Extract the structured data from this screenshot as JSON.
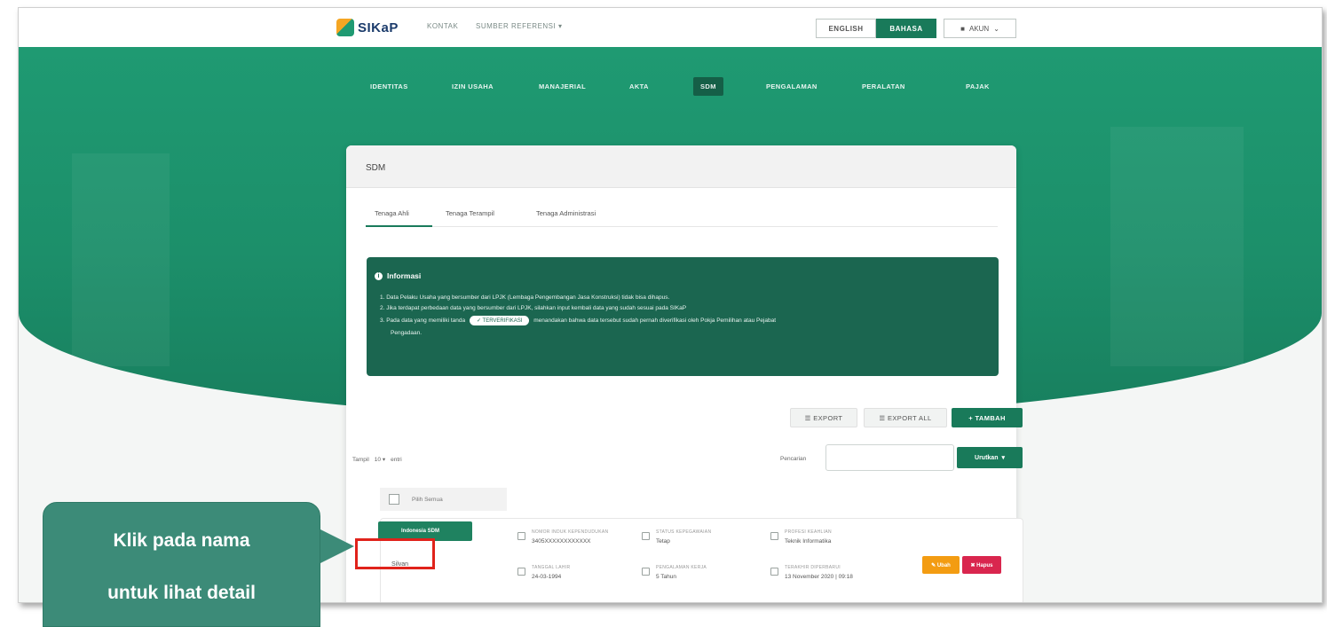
{
  "header": {
    "logo_text": "SIKaP",
    "links": [
      "KONTAK",
      "SUMBER REFERENSI ▾"
    ],
    "lang_en": "ENGLISH",
    "lang_id": "BAHASA",
    "account": "AKUN"
  },
  "nav": [
    "IDENTITAS",
    "IZIN USAHA",
    "MANAJERIAL",
    "AKTA",
    "SDM",
    "PENGALAMAN",
    "PERALATAN",
    "PAJAK"
  ],
  "nav_active": "SDM",
  "card": {
    "title": "SDM",
    "tabs": [
      "Tenaga Ahli",
      "Tenaga Terampil",
      "Tenaga Administrasi"
    ]
  },
  "info": {
    "title": "Informasi",
    "line1": "1. Data Pelaku Usaha yang bersumber dari LPJK (Lembaga Pengembangan Jasa Konstruksi) tidak bisa dihapus.",
    "line2": "2. Jika terdapat perbedaan data yang bersumber dari LPJK, silahkan input kembali data yang sudah sesuai pada SIKaP",
    "line3a": "3. Pada data yang memiliki tanda",
    "pill": "✓ TERVERIFIKASI",
    "line3b": "menandakan bahwa data tersebut sudah pernah diverifikasi oleh Pokja Pemilihan atau Pejabat",
    "line4": "Pengadaan."
  },
  "toolbar": {
    "export": "☰ EXPORT",
    "export_all": "☰ EXPORT ALL",
    "tambah": "+ TAMBAH",
    "show": [
      "Tampil",
      "10 ▾",
      "entri"
    ],
    "search_label": "Pencarian",
    "urutkan": "Urutkan"
  },
  "list": {
    "select_all": "Pilih Semua",
    "row": {
      "badge": "Indonesia SDM",
      "name": "Silvan",
      "fields": [
        {
          "label": "NOMOR INDUK KEPENDUDUKAN",
          "value": "3405XXXXXXXXXXXX"
        },
        {
          "label": "TANGGAL LAHIR",
          "value": "24-03-1994"
        },
        {
          "label": "STATUS KEPEGAWAIAN",
          "value": "Tetap"
        },
        {
          "label": "PENGALAMAN KERJA",
          "value": "5 Tahun"
        },
        {
          "label": "PROFESI KEAHLIAN",
          "value": "Teknik Informatika"
        },
        {
          "label": "TERAKHIR DIPERBARUI",
          "value": "13 November 2020 | 09:18"
        }
      ],
      "ubah": "✎ Ubah",
      "hapus": "✖ Hapus"
    }
  },
  "callout": {
    "line1": "Klik pada nama",
    "line2": "untuk lihat detail"
  }
}
